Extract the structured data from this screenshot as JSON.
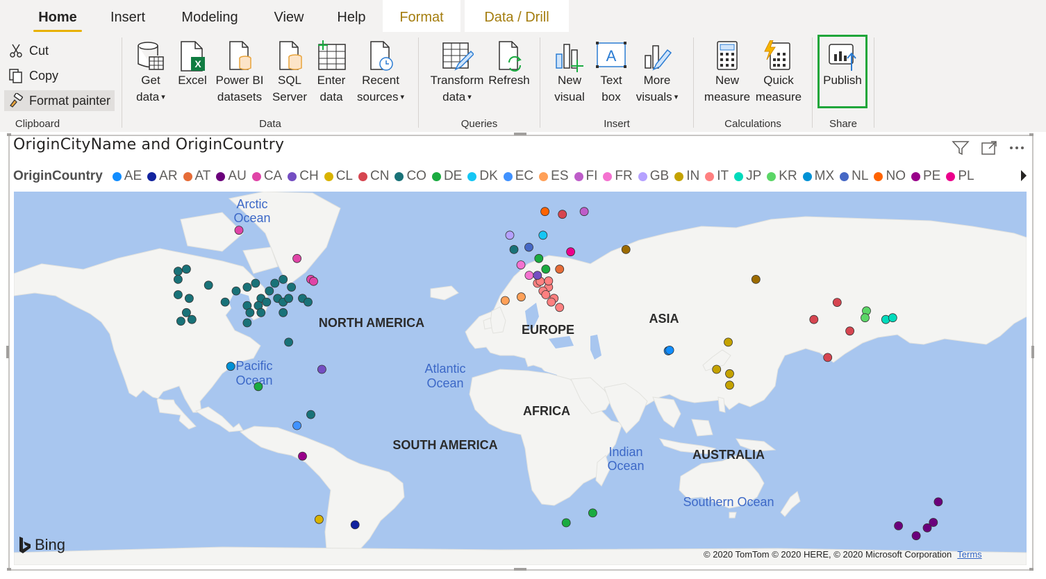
{
  "ribbon": {
    "tabs": [
      {
        "label": "Home",
        "active": true
      },
      {
        "label": "Insert"
      },
      {
        "label": "Modeling"
      },
      {
        "label": "View"
      },
      {
        "label": "Help"
      },
      {
        "label": "Format",
        "contextual": true
      },
      {
        "label": "Data / Drill",
        "contextual": true
      }
    ],
    "clipboard": {
      "cut": "Cut",
      "copy": "Copy",
      "format_painter": "Format painter",
      "group": "Clipboard"
    },
    "data": {
      "get_data": [
        "Get",
        "data"
      ],
      "excel": [
        "Excel"
      ],
      "pbi_datasets": [
        "Power BI",
        "datasets"
      ],
      "sql_server": [
        "SQL",
        "Server"
      ],
      "enter_data": [
        "Enter",
        "data"
      ],
      "recent_sources": [
        "Recent",
        "sources"
      ],
      "group": "Data"
    },
    "queries": {
      "transform": [
        "Transform",
        "data"
      ],
      "refresh": [
        "Refresh"
      ],
      "group": "Queries"
    },
    "insert": {
      "new_visual": [
        "New",
        "visual"
      ],
      "text_box": [
        "Text",
        "box"
      ],
      "more_visuals": [
        "More",
        "visuals"
      ],
      "group": "Insert"
    },
    "calculations": {
      "new_measure": [
        "New",
        "measure"
      ],
      "quick_measure": [
        "Quick",
        "measure"
      ],
      "group": "Calculations"
    },
    "share": {
      "publish": "Publish",
      "group": "Share"
    }
  },
  "visual": {
    "title": "OriginCityName and OriginCountry",
    "legend_title": "OriginCountry",
    "legend": [
      {
        "code": "AE",
        "color": "#118dff"
      },
      {
        "code": "AR",
        "color": "#12239e"
      },
      {
        "code": "AT",
        "color": "#e66c37"
      },
      {
        "code": "AU",
        "color": "#6b007b"
      },
      {
        "code": "CA",
        "color": "#e044a7"
      },
      {
        "code": "CH",
        "color": "#744ec2"
      },
      {
        "code": "CL",
        "color": "#d9b300"
      },
      {
        "code": "CN",
        "color": "#d64550"
      },
      {
        "code": "CO",
        "color": "#197278"
      },
      {
        "code": "DE",
        "color": "#1aab40"
      },
      {
        "code": "DK",
        "color": "#15c6f4"
      },
      {
        "code": "EC",
        "color": "#4092ff"
      },
      {
        "code": "ES",
        "color": "#ffa058"
      },
      {
        "code": "FI",
        "color": "#be5dc9"
      },
      {
        "code": "FR",
        "color": "#f472d0"
      },
      {
        "code": "GB",
        "color": "#b5a1ff"
      },
      {
        "code": "IN",
        "color": "#c4a200"
      },
      {
        "code": "IT",
        "color": "#ff8080"
      },
      {
        "code": "JP",
        "color": "#00dbbc"
      },
      {
        "code": "KR",
        "color": "#5bd667"
      },
      {
        "code": "MX",
        "color": "#0091d5"
      },
      {
        "code": "NL",
        "color": "#4668c5"
      },
      {
        "code": "NO",
        "color": "#ff6300"
      },
      {
        "code": "PE",
        "color": "#99008a"
      },
      {
        "code": "PL",
        "color": "#ec008c"
      }
    ]
  },
  "map": {
    "oceans": [
      [
        "Arctic",
        "Ocean"
      ],
      [
        "Pacific",
        "Ocean"
      ],
      [
        "Atlantic",
        "Ocean"
      ],
      [
        "Indian",
        "Ocean"
      ],
      [
        "Southern Ocean"
      ]
    ],
    "continents": [
      "NORTH AMERICA",
      "EUROPE",
      "ASIA",
      "AFRICA",
      "SOUTH AMERICA",
      "AUSTRALIA"
    ],
    "points": [
      {
        "c": "#e044a7",
        "lon": -100,
        "lat": 57
      },
      {
        "c": "#e044a7",
        "lon": -79,
        "lat": 51
      },
      {
        "c": "#e044a7",
        "lon": -74,
        "lat": 46
      },
      {
        "c": "#e044a7",
        "lon": -73,
        "lat": 45.5
      },
      {
        "c": "#197278",
        "lon": -122,
        "lat": 48
      },
      {
        "c": "#197278",
        "lon": -119,
        "lat": 48.5
      },
      {
        "c": "#197278",
        "lon": -122,
        "lat": 46
      },
      {
        "c": "#197278",
        "lon": -122,
        "lat": 42
      },
      {
        "c": "#197278",
        "lon": -118,
        "lat": 41
      },
      {
        "c": "#197278",
        "lon": -119,
        "lat": 37
      },
      {
        "c": "#197278",
        "lon": -117,
        "lat": 35
      },
      {
        "c": "#197278",
        "lon": -121,
        "lat": 34.5
      },
      {
        "c": "#197278",
        "lon": -111,
        "lat": 44.5
      },
      {
        "c": "#197278",
        "lon": -105,
        "lat": 40
      },
      {
        "c": "#197278",
        "lon": -101,
        "lat": 43
      },
      {
        "c": "#197278",
        "lon": -97,
        "lat": 44
      },
      {
        "c": "#197278",
        "lon": -94,
        "lat": 45
      },
      {
        "c": "#197278",
        "lon": -92,
        "lat": 41
      },
      {
        "c": "#197278",
        "lon": -89,
        "lat": 43
      },
      {
        "c": "#197278",
        "lon": -87,
        "lat": 45
      },
      {
        "c": "#197278",
        "lon": -84,
        "lat": 46
      },
      {
        "c": "#197278",
        "lon": -81,
        "lat": 44
      },
      {
        "c": "#197278",
        "lon": -97,
        "lat": 39
      },
      {
        "c": "#197278",
        "lon": -93,
        "lat": 39
      },
      {
        "c": "#197278",
        "lon": -90,
        "lat": 40
      },
      {
        "c": "#197278",
        "lon": -86,
        "lat": 41
      },
      {
        "c": "#197278",
        "lon": -84,
        "lat": 40
      },
      {
        "c": "#197278",
        "lon": -96,
        "lat": 37
      },
      {
        "c": "#197278",
        "lon": -97,
        "lat": 34
      },
      {
        "c": "#197278",
        "lon": -84,
        "lat": 37
      },
      {
        "c": "#197278",
        "lon": -82,
        "lat": 41
      },
      {
        "c": "#197278",
        "lon": -77,
        "lat": 41
      },
      {
        "c": "#197278",
        "lon": -75,
        "lat": 40
      },
      {
        "c": "#197278",
        "lon": -92,
        "lat": 37
      },
      {
        "c": "#197278",
        "lon": -82,
        "lat": 28
      },
      {
        "c": "#197278",
        "lon": -74,
        "lat": 3
      },
      {
        "c": "#0091d5",
        "lon": -103,
        "lat": 20
      },
      {
        "c": "#1aab40",
        "lon": -93,
        "lat": 13
      },
      {
        "c": "#744ec2",
        "lon": -70,
        "lat": 19
      },
      {
        "c": "#4092ff",
        "lon": -79,
        "lat": -1
      },
      {
        "c": "#99008a",
        "lon": -77,
        "lat": -12
      },
      {
        "c": "#d9b300",
        "lon": -71,
        "lat": -33
      },
      {
        "c": "#12239e",
        "lon": -58,
        "lat": -34.6
      },
      {
        "c": "#b5a1ff",
        "lon": -2,
        "lat": 56
      },
      {
        "c": "#197278",
        "lon": -0.5,
        "lat": 53
      },
      {
        "c": "#4668c5",
        "lon": 4.9,
        "lat": 53.5
      },
      {
        "c": "#1aab40",
        "lon": 8.5,
        "lat": 51
      },
      {
        "c": "#1aab40",
        "lon": 11,
        "lat": 48.5
      },
      {
        "c": "#e66c37",
        "lon": 16,
        "lat": 48.5
      },
      {
        "c": "#ec008c",
        "lon": 20,
        "lat": 52.5
      },
      {
        "c": "#f472d0",
        "lon": 2,
        "lat": 49.5
      },
      {
        "c": "#f472d0",
        "lon": 5,
        "lat": 47
      },
      {
        "c": "#ff8080",
        "lon": 8,
        "lat": 45
      },
      {
        "c": "#ff8080",
        "lon": 12,
        "lat": 44
      },
      {
        "c": "#ff8080",
        "lon": 10,
        "lat": 43
      },
      {
        "c": "#ff8080",
        "lon": 14,
        "lat": 41
      },
      {
        "c": "#ff8080",
        "lon": 11,
        "lat": 42
      },
      {
        "c": "#ff8080",
        "lon": 13,
        "lat": 40
      },
      {
        "c": "#ff8080",
        "lon": 16,
        "lat": 38.5
      },
      {
        "c": "#ff8080",
        "lon": 9,
        "lat": 45.5
      },
      {
        "c": "#ff8080",
        "lon": 12,
        "lat": 45.6
      },
      {
        "c": "#744ec2",
        "lon": 8,
        "lat": 47
      },
      {
        "c": "#ffa058",
        "lon": -3.7,
        "lat": 40.4
      },
      {
        "c": "#ffa058",
        "lon": 2.1,
        "lat": 41.4
      },
      {
        "c": "#15c6f4",
        "lon": 10,
        "lat": 56
      },
      {
        "c": "#ff6300",
        "lon": 10.7,
        "lat": 60.5
      },
      {
        "c": "#d64550",
        "lon": 17,
        "lat": 60
      },
      {
        "c": "#be5dc9",
        "lon": 24.9,
        "lat": 60.5
      },
      {
        "c": "#9c6b00",
        "lon": 37,
        "lat": 68
      },
      {
        "c": "#9c6b00",
        "lon": 40,
        "lat": 53
      },
      {
        "c": "#1aab40",
        "lon": 18.4,
        "lat": -34
      },
      {
        "c": "#1aab40",
        "lon": 28,
        "lat": -31
      },
      {
        "c": "#118dff",
        "lon": 55.3,
        "lat": 25.2
      },
      {
        "c": "#118dff",
        "lon": 55.8,
        "lat": 25.4
      },
      {
        "c": "#c4a200",
        "lon": 77,
        "lat": 28
      },
      {
        "c": "#c4a200",
        "lon": 72.8,
        "lat": 19
      },
      {
        "c": "#c4a200",
        "lon": 77.5,
        "lat": 17.5
      },
      {
        "c": "#c4a200",
        "lon": 77.5,
        "lat": 13.5
      },
      {
        "c": "#9c6b00",
        "lon": 87,
        "lat": 46
      },
      {
        "c": "#d64550",
        "lon": 116.4,
        "lat": 39.9
      },
      {
        "c": "#d64550",
        "lon": 108,
        "lat": 35
      },
      {
        "c": "#d64550",
        "lon": 113,
        "lat": 23
      },
      {
        "c": "#d64550",
        "lon": 121,
        "lat": 31.5
      },
      {
        "c": "#5bd667",
        "lon": 127,
        "lat": 37.5
      },
      {
        "c": "#5bd667",
        "lon": 126.5,
        "lat": 35.5
      },
      {
        "c": "#00dbbc",
        "lon": 134,
        "lat": 35
      },
      {
        "c": "#00dbbc",
        "lon": 136.5,
        "lat": 35.5
      },
      {
        "c": "#6b007b",
        "lon": 153,
        "lat": -27.5
      },
      {
        "c": "#6b007b",
        "lon": 151.2,
        "lat": -33.9
      },
      {
        "c": "#6b007b",
        "lon": 145,
        "lat": -37.8
      },
      {
        "c": "#6b007b",
        "lon": 138.6,
        "lat": -34.9
      },
      {
        "c": "#6b007b",
        "lon": 149,
        "lat": -35.5
      }
    ],
    "provider": "Bing",
    "copyright": "© 2020 TomTom © 2020 HERE, © 2020 Microsoft Corporation",
    "terms": "Terms"
  }
}
